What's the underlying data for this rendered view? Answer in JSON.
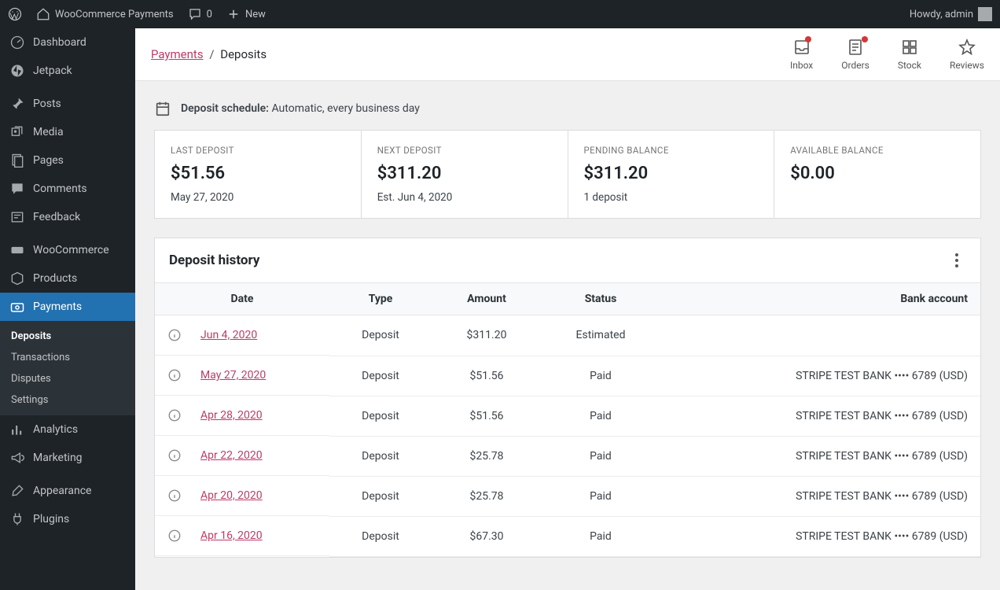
{
  "adminbar": {
    "site_title": "WooCommerce Payments",
    "comments_count": "0",
    "new_label": "New",
    "howdy": "Howdy, admin"
  },
  "sidebar": {
    "items": [
      {
        "label": "Dashboard"
      },
      {
        "label": "Jetpack"
      },
      {
        "label": "Posts"
      },
      {
        "label": "Media"
      },
      {
        "label": "Pages"
      },
      {
        "label": "Comments"
      },
      {
        "label": "Feedback"
      },
      {
        "label": "WooCommerce"
      },
      {
        "label": "Products"
      },
      {
        "label": "Payments"
      },
      {
        "label": "Analytics"
      },
      {
        "label": "Marketing"
      },
      {
        "label": "Appearance"
      },
      {
        "label": "Plugins"
      }
    ],
    "submenu": [
      {
        "label": "Deposits",
        "active": true
      },
      {
        "label": "Transactions"
      },
      {
        "label": "Disputes"
      },
      {
        "label": "Settings"
      }
    ]
  },
  "breadcrumb": {
    "root": "Payments",
    "sep": "/",
    "current": "Deposits"
  },
  "activity": {
    "inbox": "Inbox",
    "orders": "Orders",
    "stock": "Stock",
    "reviews": "Reviews"
  },
  "schedule": {
    "label": "Deposit schedule:",
    "value": "Automatic, every business day"
  },
  "stats": {
    "last_deposit": {
      "title": "LAST DEPOSIT",
      "value": "$51.56",
      "sub": "May 27, 2020"
    },
    "next_deposit": {
      "title": "NEXT DEPOSIT",
      "value": "$311.20",
      "sub": "Est. Jun 4, 2020"
    },
    "pending": {
      "title": "PENDING BALANCE",
      "value": "$311.20",
      "sub": "1 deposit"
    },
    "available": {
      "title": "AVAILABLE BALANCE",
      "value": "$0.00",
      "sub": ""
    }
  },
  "table": {
    "title": "Deposit history",
    "columns": {
      "date": "Date",
      "type": "Type",
      "amount": "Amount",
      "status": "Status",
      "bank": "Bank account"
    },
    "rows": [
      {
        "date": "Jun 4, 2020",
        "type": "Deposit",
        "amount": "$311.20",
        "status": "Estimated",
        "bank": ""
      },
      {
        "date": "May 27, 2020",
        "type": "Deposit",
        "amount": "$51.56",
        "status": "Paid",
        "bank": "STRIPE TEST BANK •••• 6789 (USD)"
      },
      {
        "date": "Apr 28, 2020",
        "type": "Deposit",
        "amount": "$51.56",
        "status": "Paid",
        "bank": "STRIPE TEST BANK •••• 6789 (USD)"
      },
      {
        "date": "Apr 22, 2020",
        "type": "Deposit",
        "amount": "$25.78",
        "status": "Paid",
        "bank": "STRIPE TEST BANK •••• 6789 (USD)"
      },
      {
        "date": "Apr 20, 2020",
        "type": "Deposit",
        "amount": "$25.78",
        "status": "Paid",
        "bank": "STRIPE TEST BANK •••• 6789 (USD)"
      },
      {
        "date": "Apr 16, 2020",
        "type": "Deposit",
        "amount": "$67.30",
        "status": "Paid",
        "bank": "STRIPE TEST BANK •••• 6789 (USD)"
      }
    ]
  }
}
